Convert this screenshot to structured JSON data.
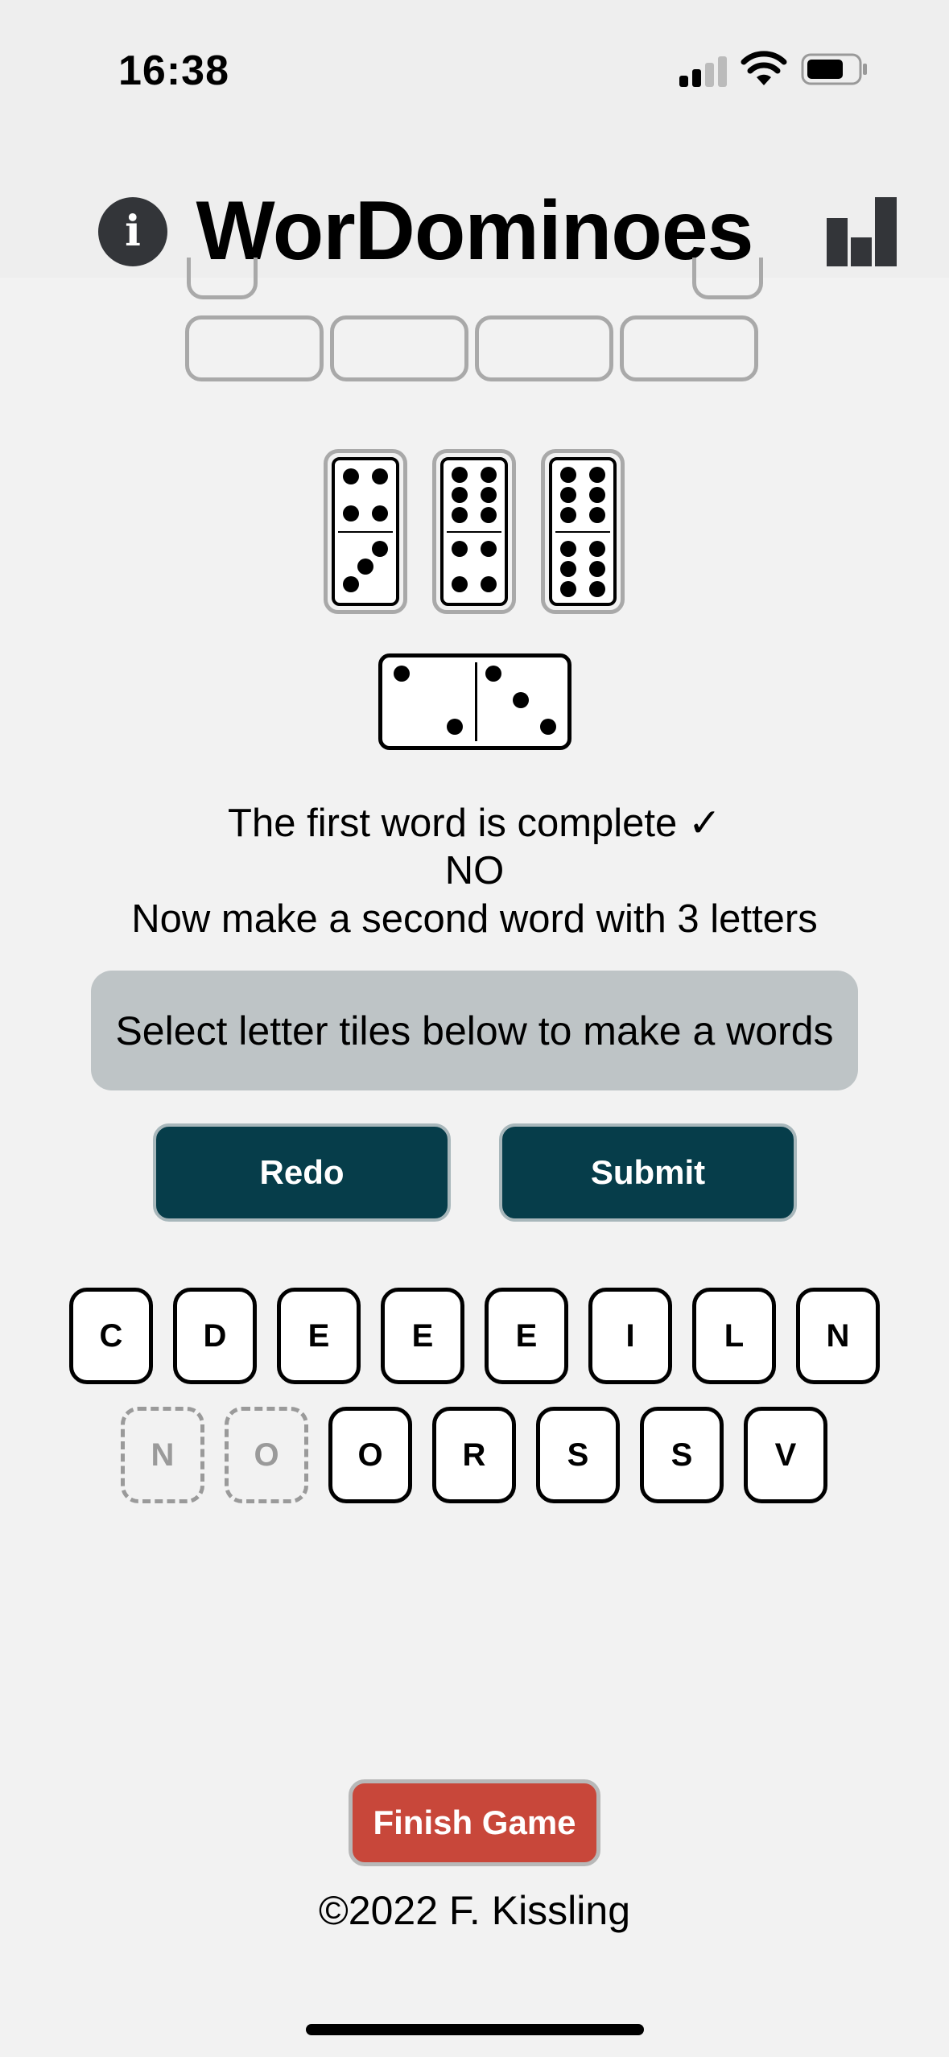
{
  "status_bar": {
    "time": "16:38"
  },
  "header": {
    "title": "WorDominoes",
    "info_icon": "i"
  },
  "messages": {
    "line1": "The first word is complete ✓",
    "line2": "NO",
    "line3": "Now make a second word with 3 letters"
  },
  "word_input": {
    "placeholder": "Select letter tiles below to make a words"
  },
  "buttons": {
    "redo": "Redo",
    "submit": "Submit",
    "finish": "Finish Game"
  },
  "tiles_row1": [
    "C",
    "D",
    "E",
    "E",
    "E",
    "I",
    "L",
    "N"
  ],
  "tiles_row2": [
    {
      "letter": "N",
      "used": true
    },
    {
      "letter": "O",
      "used": true
    },
    {
      "letter": "O",
      "used": false
    },
    {
      "letter": "R",
      "used": false
    },
    {
      "letter": "S",
      "used": false
    },
    {
      "letter": "S",
      "used": false
    },
    {
      "letter": "V",
      "used": false
    }
  ],
  "dominoes": {
    "options": [
      [
        4,
        3
      ],
      [
        6,
        4
      ],
      [
        6,
        6
      ]
    ],
    "placed": [
      2,
      3
    ]
  },
  "footer": "©2022 F. Kissling"
}
